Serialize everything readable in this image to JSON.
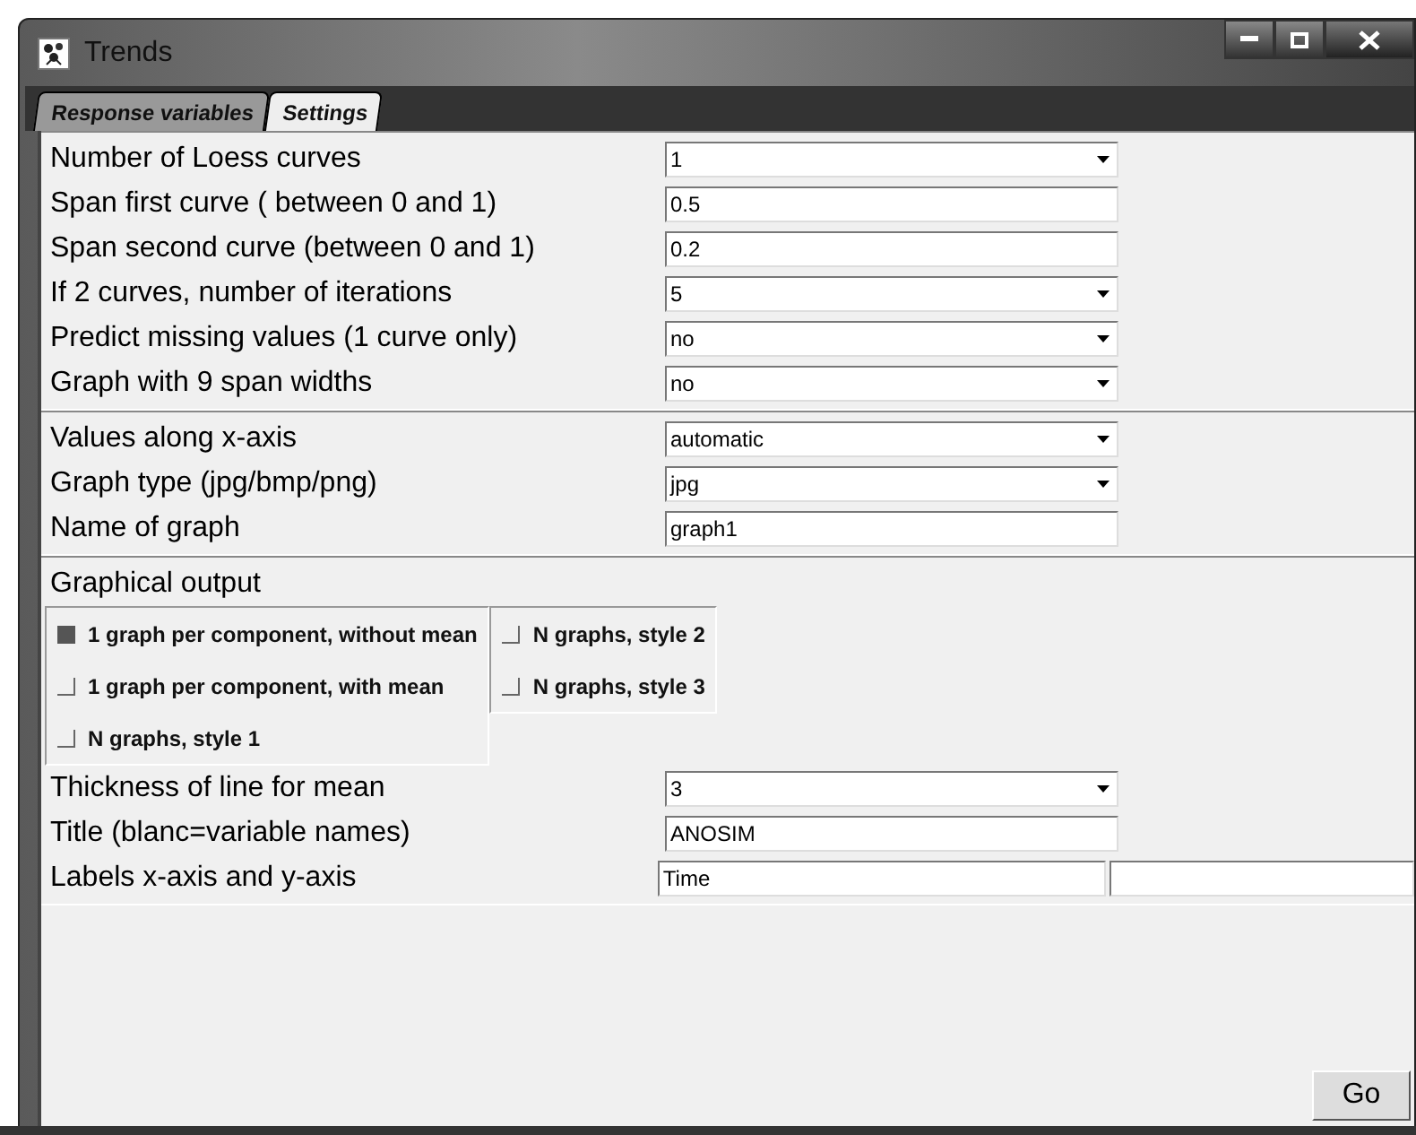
{
  "window": {
    "title": "Trends"
  },
  "tabs": [
    {
      "label": "Response variables",
      "selected": false
    },
    {
      "label": "Settings",
      "selected": true
    }
  ],
  "sections": [
    {
      "rows": [
        {
          "kind": "select",
          "label": "Number of Loess curves",
          "value": "1"
        },
        {
          "kind": "text",
          "label": "Span first curve ( between 0 and 1)",
          "value": "0.5"
        },
        {
          "kind": "text",
          "label": "Span second curve (between 0 and 1)",
          "value": "0.2"
        },
        {
          "kind": "select",
          "label": "If 2 curves, number of iterations",
          "value": "5"
        },
        {
          "kind": "select",
          "label": "Predict missing values (1 curve only)",
          "value": "no"
        },
        {
          "kind": "select",
          "label": "Graph with 9 span widths",
          "value": "no"
        }
      ]
    },
    {
      "rows": [
        {
          "kind": "select",
          "label": "Values along x-axis",
          "value": "automatic"
        },
        {
          "kind": "select",
          "label": "Graph type (jpg/bmp/png)",
          "value": "jpg"
        },
        {
          "kind": "text",
          "label": "Name of graph",
          "value": "graph1"
        }
      ]
    }
  ],
  "graphical_output": {
    "label": "Graphical output",
    "columns": [
      [
        {
          "label": "1 graph per component, without mean",
          "selected": true
        },
        {
          "label": "1 graph per component, with mean",
          "selected": false
        },
        {
          "label": "N graphs, style 1",
          "selected": false
        }
      ],
      [
        {
          "label": "N graphs, style 2",
          "selected": false
        },
        {
          "label": "N graphs, style 3",
          "selected": false
        }
      ]
    ]
  },
  "bottom_rows": [
    {
      "kind": "select",
      "label": "Thickness of line for mean",
      "value": "3"
    },
    {
      "kind": "text",
      "label": "Title (blanc=variable names)",
      "value": "ANOSIM"
    },
    {
      "kind": "text_pair",
      "label": "Labels x-axis and y-axis",
      "value": "Time",
      "value_2": ""
    }
  ],
  "go_button": "Go"
}
